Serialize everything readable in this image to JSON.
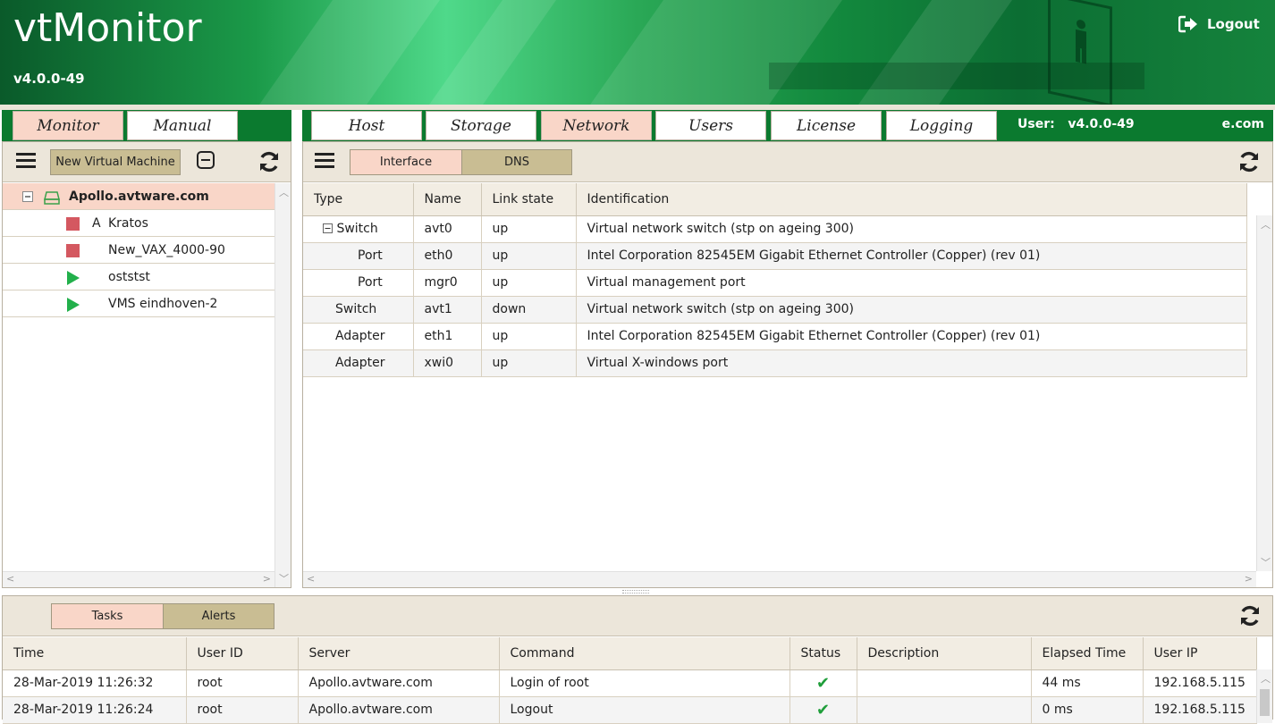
{
  "header": {
    "app_title": "vtMonitor",
    "version": "v4.0.0-49",
    "logout_label": "Logout"
  },
  "left_tabs": [
    {
      "label": "Monitor",
      "active": true
    },
    {
      "label": "Manual",
      "active": false
    }
  ],
  "right_tabs": [
    {
      "label": "Host",
      "active": false
    },
    {
      "label": "Storage",
      "active": false
    },
    {
      "label": "Network",
      "active": true
    },
    {
      "label": "Users",
      "active": false
    },
    {
      "label": "License",
      "active": false
    },
    {
      "label": "Logging",
      "active": false
    }
  ],
  "user_bar": {
    "user_label": "User:",
    "user_value": "v4.0.0-49",
    "domain_fragment": "e.com"
  },
  "monitor": {
    "new_vm_label": "New Virtual Machine",
    "tree": {
      "root": "Apollo.avtware.com",
      "vms": [
        {
          "flag": "A",
          "name": "Kratos",
          "state": "stopped"
        },
        {
          "flag": "",
          "name": "New_VAX_4000-90",
          "state": "stopped"
        },
        {
          "flag": "",
          "name": "oststst",
          "state": "running"
        },
        {
          "flag": "",
          "name": "VMS eindhoven-2",
          "state": "running"
        }
      ]
    }
  },
  "network": {
    "subtabs": [
      {
        "label": "Interface",
        "active": true
      },
      {
        "label": "DNS",
        "active": false
      }
    ],
    "columns": [
      "Type",
      "Name",
      "Link state",
      "Identification"
    ],
    "rows": [
      {
        "type": "Switch",
        "name": "avt0",
        "link": "up",
        "ident": "Virtual network switch (stp on ageing 300)"
      },
      {
        "type": "Port",
        "name": "eth0",
        "link": "up",
        "ident": "Intel Corporation 82545EM Gigabit Ethernet Controller (Copper) (rev 01)"
      },
      {
        "type": "Port",
        "name": "mgr0",
        "link": "up",
        "ident": "Virtual management port"
      },
      {
        "type": "Switch",
        "name": "avt1",
        "link": "down",
        "ident": "Virtual network switch (stp on ageing 300)"
      },
      {
        "type": "Adapter",
        "name": "eth1",
        "link": "up",
        "ident": "Intel Corporation 82545EM Gigabit Ethernet Controller (Copper) (rev 01)"
      },
      {
        "type": "Adapter",
        "name": "xwi0",
        "link": "up",
        "ident": "Virtual X-windows port"
      }
    ]
  },
  "bottom": {
    "subtabs": [
      {
        "label": "Tasks",
        "active": true
      },
      {
        "label": "Alerts",
        "active": false
      }
    ],
    "columns": [
      "Time",
      "User ID",
      "Server",
      "Command",
      "Status",
      "Description",
      "Elapsed Time",
      "User IP"
    ],
    "rows": [
      {
        "time": "28-Mar-2019 11:26:32",
        "user": "root",
        "server": "Apollo.avtware.com",
        "command": "Login of root",
        "status": "ok",
        "description": "",
        "elapsed": "44 ms",
        "ip": "192.168.5.115"
      },
      {
        "time": "28-Mar-2019 11:26:24",
        "user": "root",
        "server": "Apollo.avtware.com",
        "command": "Logout",
        "status": "ok",
        "description": "",
        "elapsed": "0 ms",
        "ip": "192.168.5.115"
      }
    ]
  },
  "colors": {
    "brand_green": "#0b7a2f",
    "active_tab": "#f9d6c8",
    "inactive_button": "#c9bd93",
    "stopped": "#d45860",
    "running": "#22b04b"
  }
}
